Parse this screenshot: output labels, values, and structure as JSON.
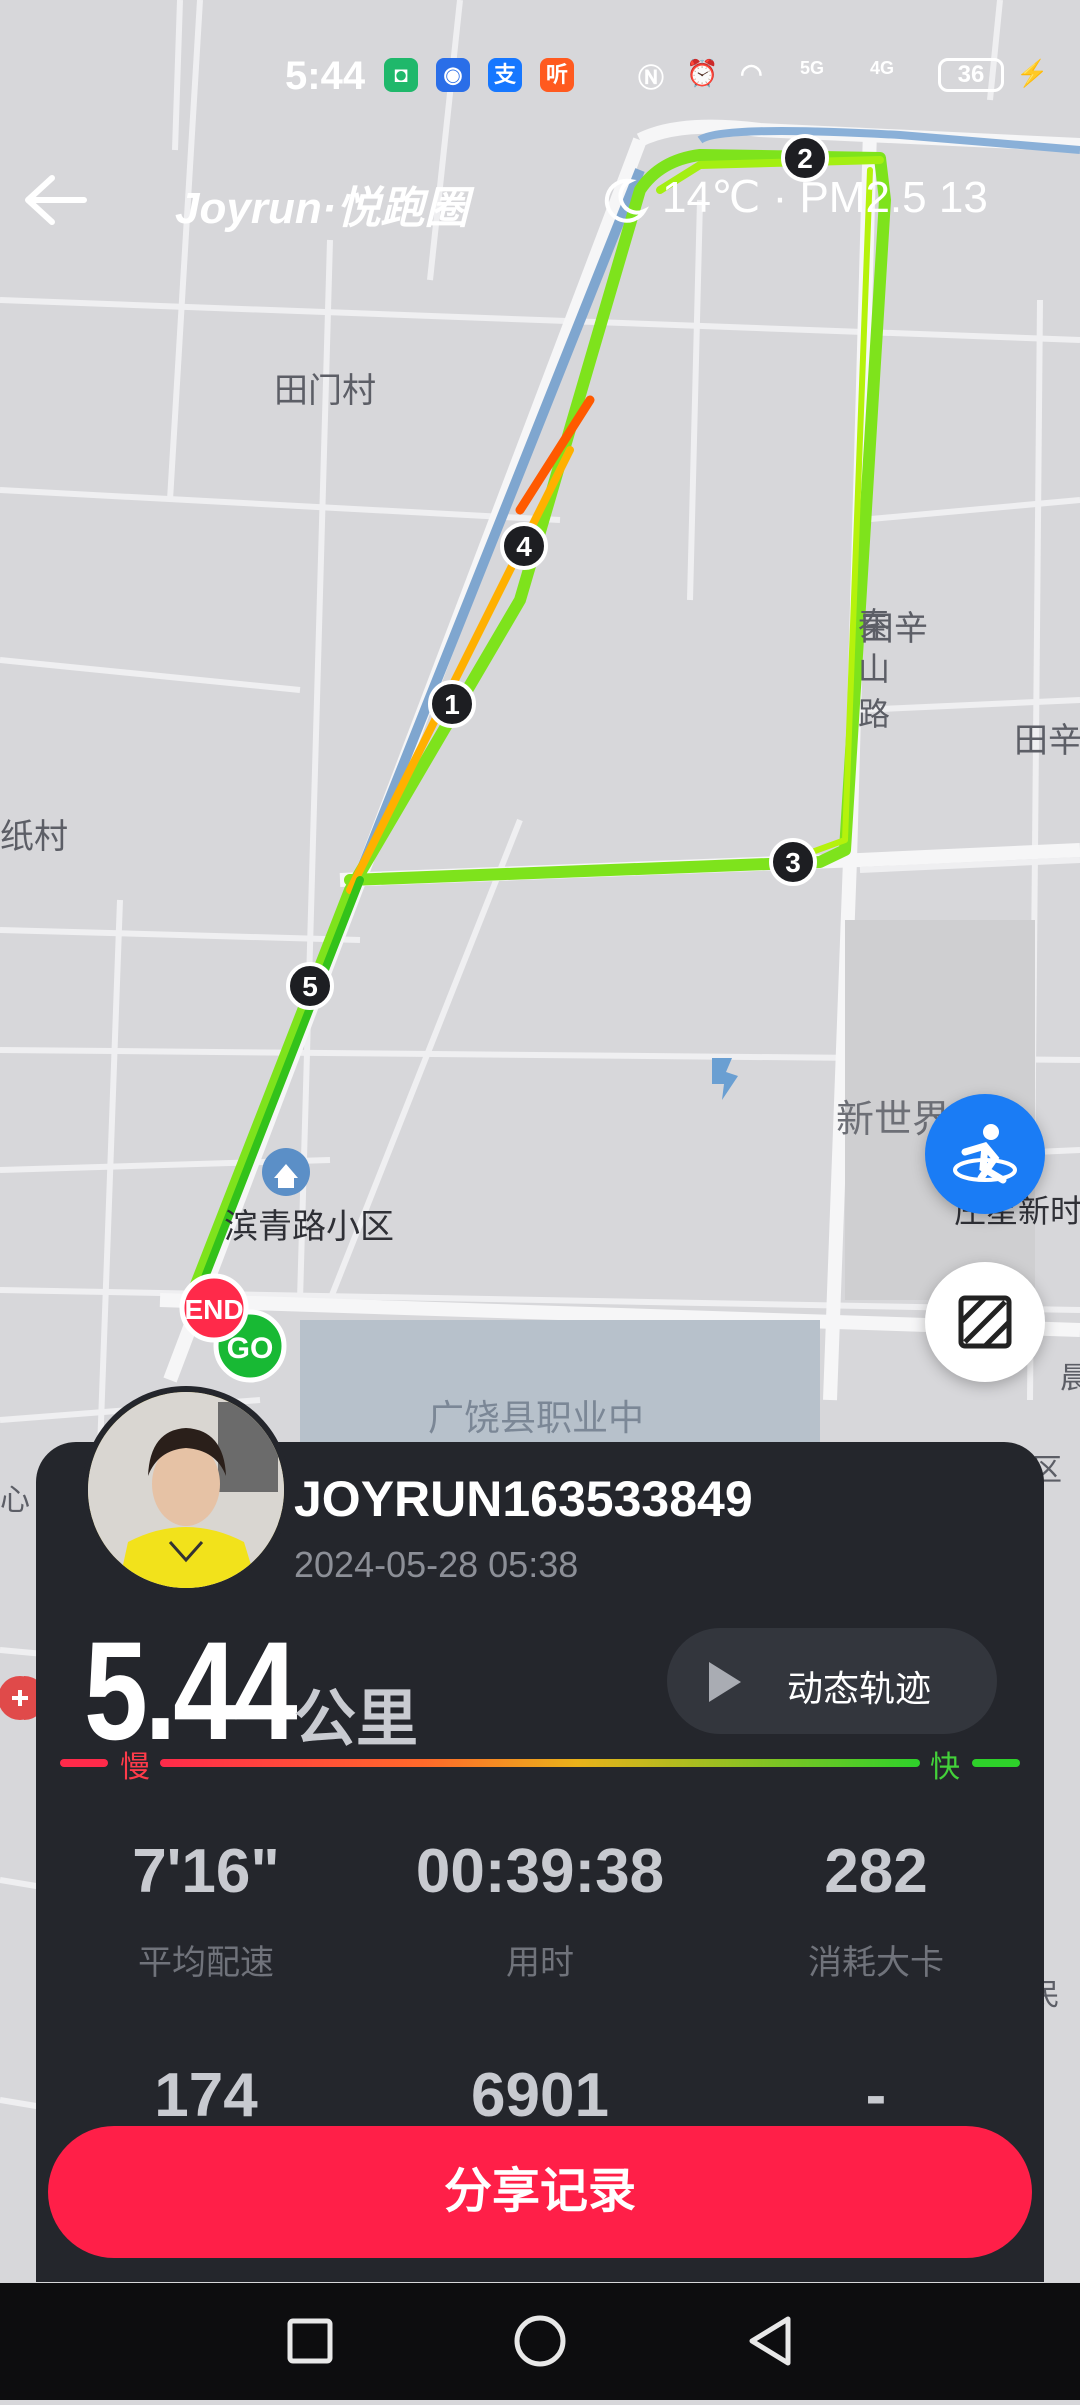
{
  "status_bar": {
    "time": "5:44",
    "battery": "36",
    "network_5g": "5G",
    "network_4g": "4G",
    "app_icon_3": "支",
    "app_icon_4": "听"
  },
  "header": {
    "brand": "Joyrun·悦跑圈",
    "weather": "14℃ · PM2.5 13"
  },
  "map": {
    "places": [
      "田门村",
      "秦山路",
      "田辛",
      "纸村",
      "新世界",
      "区",
      "庄星新时",
      "滨青路小区",
      "广饶县职业中",
      "心",
      "晨",
      "区",
      "民"
    ],
    "km_markers": [
      "1",
      "2",
      "3",
      "4",
      "5"
    ],
    "end_label": "END",
    "go_label": "GO"
  },
  "panel": {
    "username": "JOYRUN163533849",
    "datetime": "2024-05-28 05:38",
    "distance": "5.44",
    "distance_unit": "公里",
    "replay_label": "动态轨迹",
    "pace_slow": "慢",
    "pace_fast": "快",
    "stats": [
      {
        "value": "7'16\"",
        "label": "平均配速"
      },
      {
        "value": "00:39:38",
        "label": "用时"
      },
      {
        "value": "282",
        "label": "消耗大卡"
      },
      {
        "value": "174",
        "label": ""
      },
      {
        "value": "6901",
        "label": ""
      },
      {
        "value": "-",
        "label": ""
      }
    ],
    "share_label": "分享记录"
  },
  "colors": {
    "accent": "#ff1f48",
    "panel": "#24262c",
    "fab_blue": "#1a7cf5",
    "route_green": "#8de81a"
  }
}
